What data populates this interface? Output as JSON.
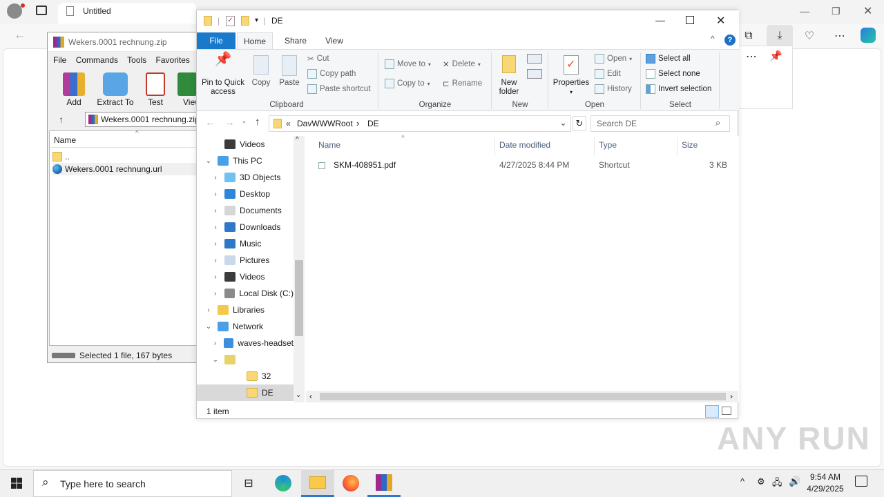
{
  "edge": {
    "tab_title": "Untitled"
  },
  "winrar": {
    "title": "Wekers.0001 rechnung.zip",
    "menu": [
      "File",
      "Commands",
      "Tools",
      "Favorites"
    ],
    "tools": [
      "Add",
      "Extract To",
      "Test",
      "View"
    ],
    "path": "Wekers.0001 rechnung.zip",
    "column_name": "Name",
    "files": [
      {
        "name": "..",
        "icon": "folder-icon"
      },
      {
        "name": "Wekers.0001 rechnung.url",
        "icon": "globe-icon"
      }
    ],
    "status": "Selected 1 file, 167 bytes"
  },
  "explorer": {
    "title": "DE",
    "ribbon_tabs": [
      "File",
      "Home",
      "Share",
      "View"
    ],
    "clipboard": {
      "pin": "Pin to Quick access",
      "copy": "Copy",
      "paste": "Paste",
      "cut": "Cut",
      "copy_path": "Copy path",
      "paste_shortcut": "Paste shortcut",
      "label": "Clipboard"
    },
    "organize": {
      "move_to": "Move to",
      "copy_to": "Copy to",
      "delete": "Delete",
      "rename": "Rename",
      "label": "Organize"
    },
    "new": {
      "new_folder": "New folder",
      "label": "New"
    },
    "open": {
      "properties": "Properties",
      "open": "Open",
      "edit": "Edit",
      "history": "History",
      "label": "Open"
    },
    "select": {
      "select_all": "Select all",
      "select_none": "Select none",
      "invert": "Invert selection",
      "label": "Select"
    },
    "address": {
      "overflow": "«",
      "segments": [
        "DavWWWRoot",
        "DE"
      ]
    },
    "search_placeholder": "Search DE",
    "tree": [
      {
        "label": "Videos",
        "level": 2,
        "chev": "",
        "icon": "videos-icon"
      },
      {
        "label": "This PC",
        "level": 1,
        "chev": "⌄",
        "icon": "pc-icon"
      },
      {
        "label": "3D Objects",
        "level": 2,
        "chev": "›",
        "icon": "3d-objects-icon"
      },
      {
        "label": "Desktop",
        "level": 2,
        "chev": "›",
        "icon": "desktop-icon"
      },
      {
        "label": "Documents",
        "level": 2,
        "chev": "›",
        "icon": "documents-icon"
      },
      {
        "label": "Downloads",
        "level": 2,
        "chev": "›",
        "icon": "downloads-icon"
      },
      {
        "label": "Music",
        "level": 2,
        "chev": "›",
        "icon": "music-icon"
      },
      {
        "label": "Pictures",
        "level": 2,
        "chev": "›",
        "icon": "pictures-icon"
      },
      {
        "label": "Videos",
        "level": 2,
        "chev": "›",
        "icon": "videos-icon"
      },
      {
        "label": "Local Disk (C:)",
        "level": 2,
        "chev": "›",
        "icon": "disk-icon"
      },
      {
        "label": "Libraries",
        "level": 1,
        "chev": "›",
        "icon": "libraries-icon"
      },
      {
        "label": "Network",
        "level": 1,
        "chev": "⌄",
        "icon": "network-icon"
      },
      {
        "label": "waves-headset",
        "level": 2,
        "chev": "›",
        "icon": "computer-icon"
      },
      {
        "label": "",
        "level": 2,
        "chev": "⌄",
        "icon": "network-share-icon"
      },
      {
        "label": "32",
        "level": 3,
        "chev": "",
        "icon": "folder-icon"
      },
      {
        "label": "DE",
        "level": 3,
        "chev": "",
        "icon": "folder-icon",
        "selected": true
      }
    ],
    "columns": [
      "Name",
      "Date modified",
      "Type",
      "Size"
    ],
    "files": [
      {
        "name": "SKM-408951.pdf",
        "date": "4/27/2025 8:44 PM",
        "type": "Shortcut",
        "size": "3 KB"
      }
    ],
    "status": "1 item"
  },
  "taskbar": {
    "search_placeholder": "Type here to search",
    "time": "9:54 AM",
    "date": "4/29/2025"
  },
  "watermark": "ANY RUN"
}
